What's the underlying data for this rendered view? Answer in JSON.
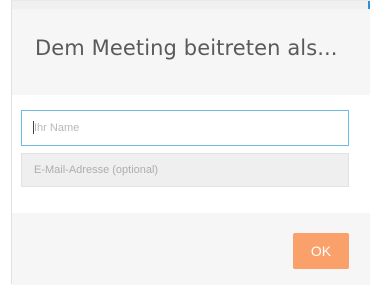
{
  "dialog": {
    "title": "Dem Meeting beitreten als...",
    "name_field": {
      "placeholder": "Ihr Name",
      "value": ""
    },
    "email_field": {
      "placeholder": "E-Mail-Adresse (optional)",
      "value": ""
    },
    "ok_label": "OK"
  },
  "colors": {
    "header_bg": "#f6f6f6",
    "title_text": "#5a5a5a",
    "focus_border": "#6dbde3",
    "ok_button_bg": "#f9a06b",
    "accent_edge": "#2e8fd6"
  }
}
